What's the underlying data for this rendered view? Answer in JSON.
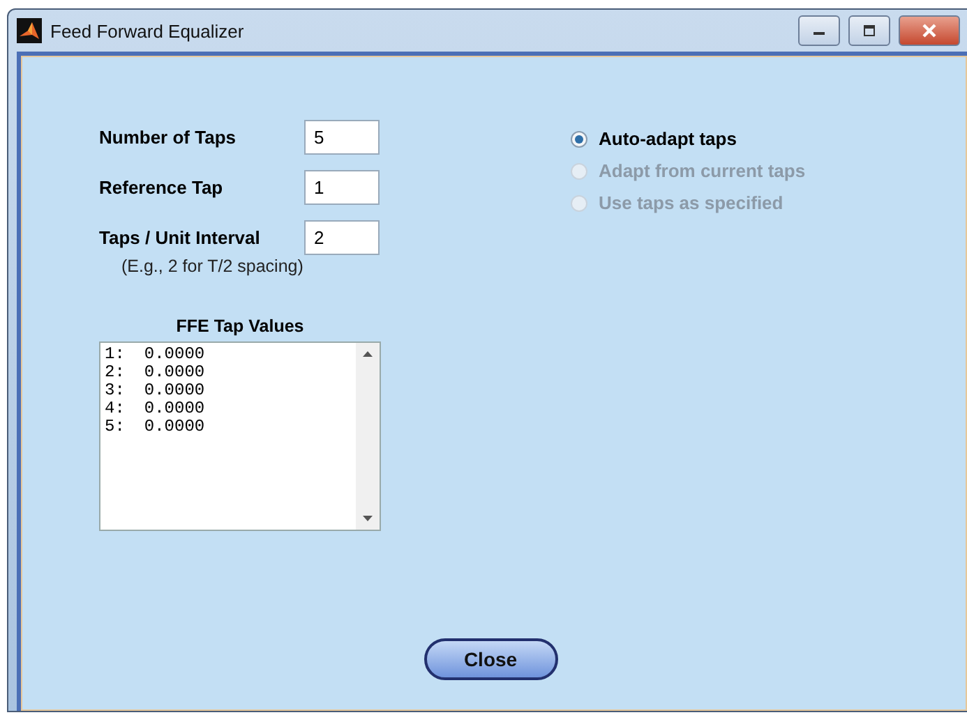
{
  "window": {
    "title": "Feed Forward Equalizer"
  },
  "fields": [
    {
      "label": "Number of Taps",
      "value": "5"
    },
    {
      "label": "Reference Tap",
      "value": "1"
    },
    {
      "label": "Taps / Unit Interval",
      "value": "2"
    }
  ],
  "hint": "(E.g., 2 for T/2 spacing)",
  "tap_values": {
    "title": "FFE Tap Values",
    "rows": [
      {
        "index": "1:",
        "value": "0.0000"
      },
      {
        "index": "2:",
        "value": "0.0000"
      },
      {
        "index": "3:",
        "value": "0.0000"
      },
      {
        "index": "4:",
        "value": "0.0000"
      },
      {
        "index": "5:",
        "value": "0.0000"
      }
    ]
  },
  "options": [
    {
      "label": "Auto-adapt taps",
      "selected": true,
      "disabled": false
    },
    {
      "label": "Adapt from current taps",
      "selected": false,
      "disabled": true
    },
    {
      "label": "Use taps as specified",
      "selected": false,
      "disabled": true
    }
  ],
  "buttons": [
    "Close"
  ]
}
